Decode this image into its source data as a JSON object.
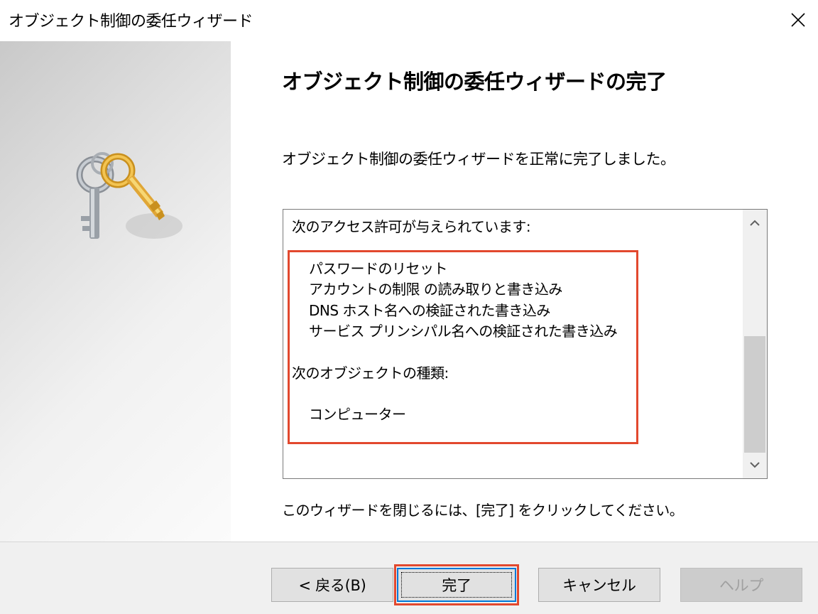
{
  "window": {
    "title": "オブジェクト制御の委任ウィザード"
  },
  "main": {
    "heading": "オブジェクト制御の委任ウィザードの完了",
    "success_message": "オブジェクト制御の委任ウィザードを正常に完了しました。",
    "summary": {
      "permissions_header": "次のアクセス許可が与えられています:",
      "permissions": [
        "パスワードのリセット",
        "アカウントの制限 の読み取りと書き込み",
        "DNS ホスト名への検証された書き込み",
        "サービス プリンシパル名への検証された書き込み"
      ],
      "object_types_header": "次のオブジェクトの種類:",
      "object_types": [
        "コンピューター"
      ]
    },
    "close_instruction": "このウィザードを閉じるには、[完了] をクリックしてください。"
  },
  "footer": {
    "back_label": "< 戻る(B)",
    "finish_label": "完了",
    "cancel_label": "キャンセル",
    "help_label": "ヘルプ"
  },
  "icons": {
    "close": "close-icon",
    "keys": "keys-icon",
    "scroll_up": "chevron-up-icon",
    "scroll_down": "chevron-down-icon"
  },
  "colors": {
    "highlight": "#e2482e",
    "focus_border": "#0078d7"
  }
}
